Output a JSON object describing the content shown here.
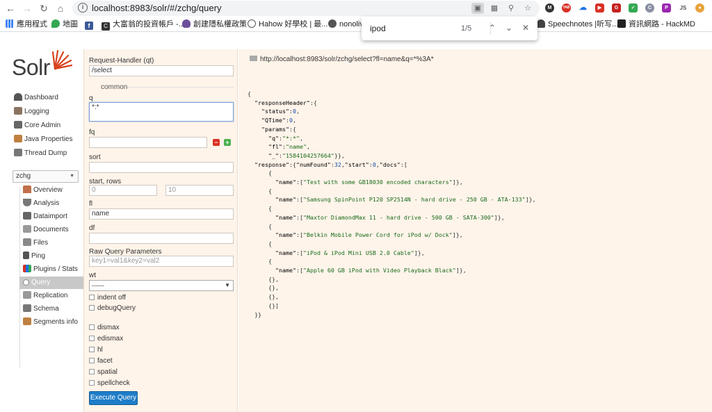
{
  "browser": {
    "url": "localhost:8983/solr/#/zchg/query",
    "extensions": [
      "M",
      "YAB",
      "cloud",
      "vid",
      "G",
      "shield",
      "C",
      "JS",
      "G2"
    ],
    "bookmarks": [
      {
        "label": "應用程式"
      },
      {
        "label": "地圖"
      },
      {
        "label": ""
      },
      {
        "label": "大富翁的投資帳戶 -..."
      },
      {
        "label": "創建隱私權政策"
      },
      {
        "label": "Hahow 好學校 | 最..."
      },
      {
        "label": "nonoliv"
      },
      {
        "label": "Speechnotes |听写..."
      },
      {
        "label": "資訊網路 - HackMD"
      }
    ],
    "find": {
      "query": "ipod",
      "count": "1/5"
    }
  },
  "sidebar": {
    "logo": "Solr",
    "menu": [
      {
        "label": "Dashboard",
        "icon": "dashboard-icon"
      },
      {
        "label": "Logging",
        "icon": "logging-icon"
      },
      {
        "label": "Core Admin",
        "icon": "core-admin-icon"
      },
      {
        "label": "Java Properties",
        "icon": "java-icon"
      },
      {
        "label": "Thread Dump",
        "icon": "thread-icon"
      }
    ],
    "core": "zchg",
    "core_menu": [
      {
        "label": "Overview"
      },
      {
        "label": "Analysis"
      },
      {
        "label": "Dataimport"
      },
      {
        "label": "Documents"
      },
      {
        "label": "Files"
      },
      {
        "label": "Ping"
      },
      {
        "label": "Plugins / Stats"
      },
      {
        "label": "Query"
      },
      {
        "label": "Replication"
      },
      {
        "label": "Schema"
      },
      {
        "label": "Segments info"
      }
    ]
  },
  "form": {
    "qt_label": "Request-Handler (qt)",
    "qt_value": "/select",
    "common_legend": "common",
    "q_label": "q",
    "q_value": "*:*",
    "fq_label": "fq",
    "fq_value": "",
    "sort_label": "sort",
    "sort_value": "",
    "start_rows_label": "start, rows",
    "start_value": "0",
    "rows_value": "10",
    "fl_label": "fl",
    "fl_value": "name",
    "df_label": "df",
    "df_value": "",
    "raw_label": "Raw Query Parameters",
    "raw_placeholder": "key1=val1&key2=val2",
    "wt_label": "wt",
    "wt_value": "------",
    "indent_label": "indent off",
    "debug_label": "debugQuery",
    "dismax_label": "dismax",
    "edismax_label": "edismax",
    "hl_label": "hl",
    "facet_label": "facet",
    "spatial_label": "spatial",
    "spellcheck_label": "spellcheck",
    "execute_label": "Execute Query"
  },
  "result": {
    "url": "http://localhost:8983/solr/zchg/select?fl=name&q=*%3A*",
    "status": "0",
    "qtime": "0",
    "q": "*:*",
    "fl": "name",
    "underscore": "1584104257664",
    "numFound": "32",
    "start": "0",
    "docs": [
      "Test with some GB18030 encoded characters",
      "Samsung SpinPoint P120 SP2514N - hard drive - 250 GB - ATA-133",
      "Maxtor DiamondMax 11 - hard drive - 500 GB - SATA-300",
      "Belkin Mobile Power Cord for iPod w/ Dock",
      "iPod & iPod Mini USB 2.0 Cable",
      "Apple 60 GB iPod with Video Playback Black"
    ]
  },
  "colors": {
    "panel_bg": "#fef4ea",
    "execute_button": "#1e7dc8",
    "active_menu": "#c8c8c8"
  }
}
